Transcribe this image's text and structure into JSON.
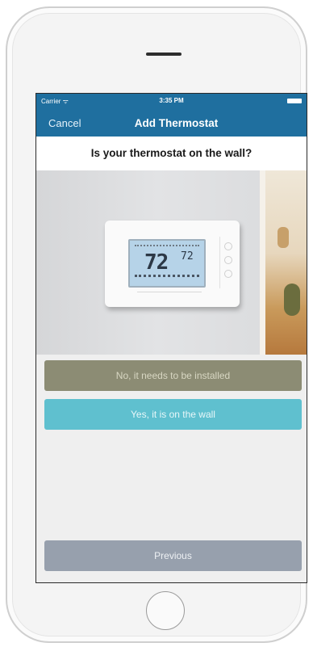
{
  "status_bar": {
    "carrier": "Carrier ᯤ",
    "time": "3:35 PM"
  },
  "nav": {
    "cancel_label": "Cancel",
    "title": "Add Thermostat"
  },
  "question": "Is your thermostat on the wall?",
  "thermostat_display": {
    "temperature": "72",
    "setpoint": "72"
  },
  "options": {
    "install_label": "No, it needs to be installed",
    "wall_label": "Yes, it is on the wall"
  },
  "footer": {
    "previous_label": "Previous"
  },
  "colors": {
    "nav_bar": "#1f6f9f",
    "install_button": "#8c8c74",
    "wall_button": "#5fc0cf",
    "previous_button": "#97a0ad"
  }
}
